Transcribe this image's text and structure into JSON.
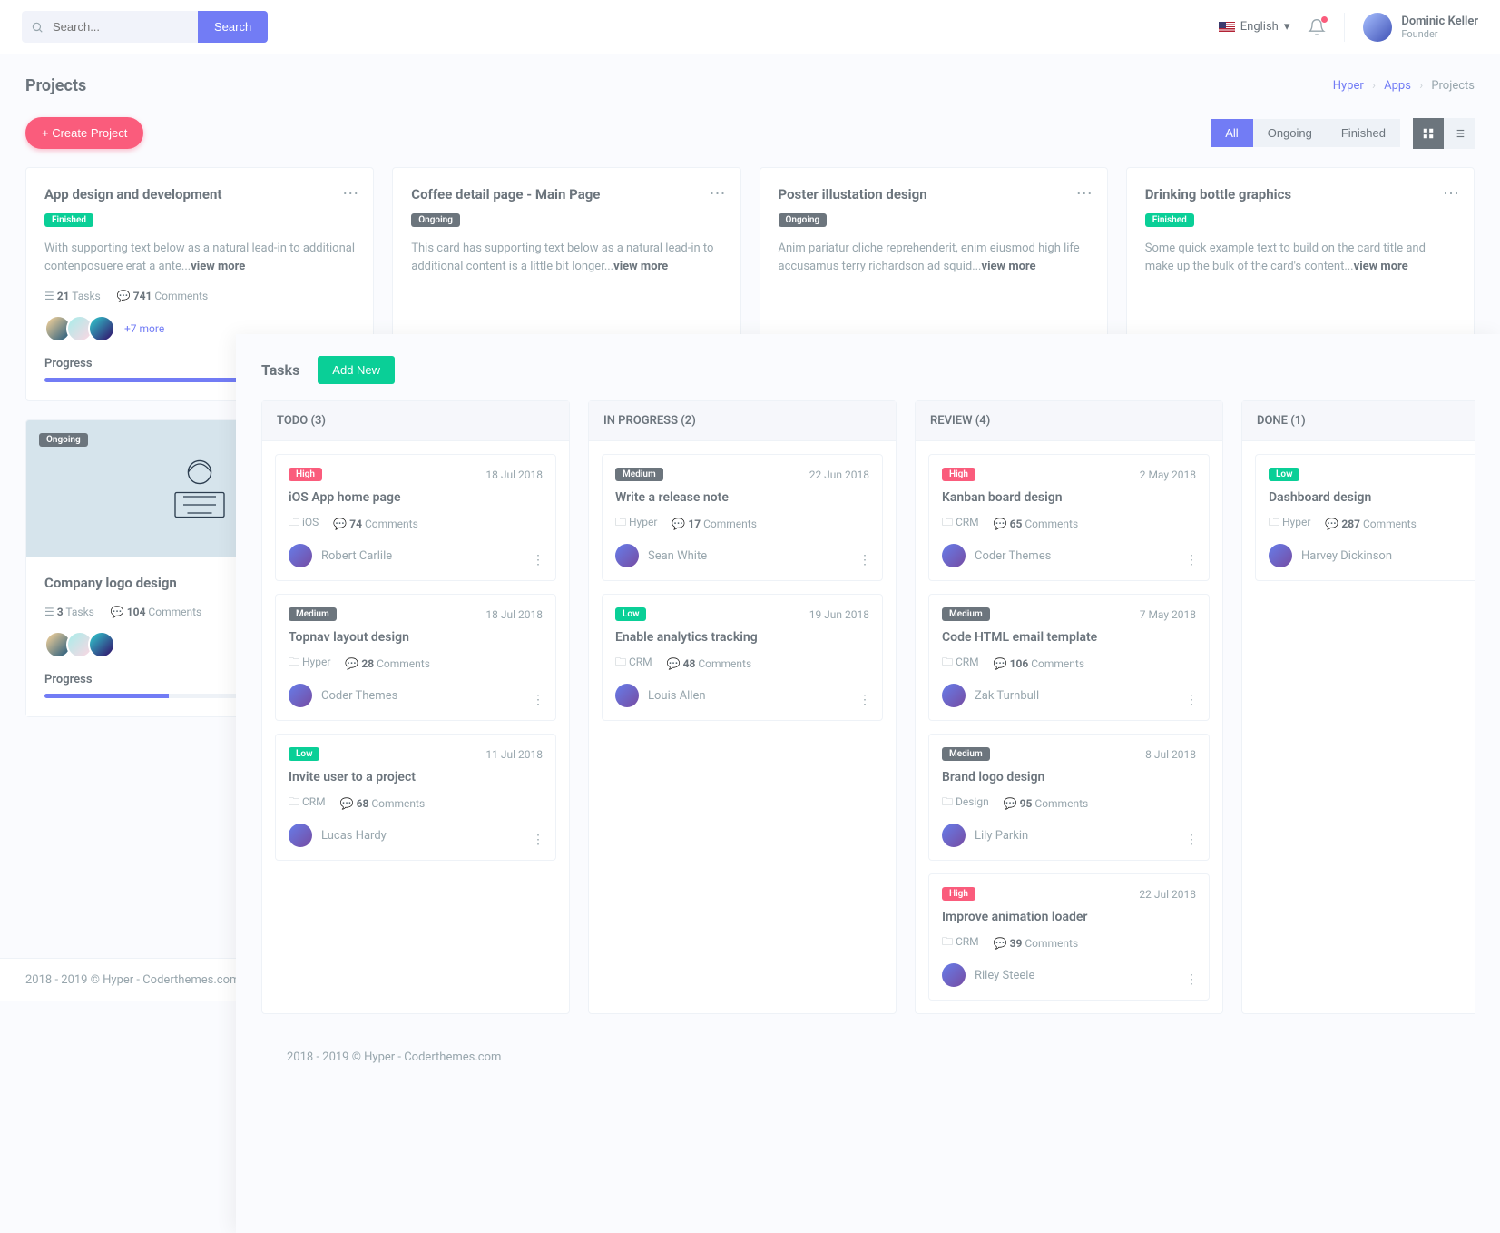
{
  "topbar": {
    "search_placeholder": "Search...",
    "search_button": "Search",
    "language": "English",
    "user_name": "Dominic Keller",
    "user_role": "Founder"
  },
  "page": {
    "title": "Projects",
    "breadcrumb": [
      "Hyper",
      "Apps",
      "Projects"
    ]
  },
  "toolbar": {
    "create_label": "Create Project",
    "filters": [
      "All",
      "Ongoing",
      "Finished"
    ],
    "active_filter": "All"
  },
  "projects": [
    {
      "title": "App design and development",
      "status": "Finished",
      "desc": "With supporting text below as a natural lead-in to additional contenposuere erat a ante...",
      "tasks": 21,
      "comments": 741,
      "extra_members": "+7 more",
      "progress": 85
    },
    {
      "title": "Coffee detail page - Main Page",
      "status": "Ongoing",
      "desc": "This card has supporting text below as a natural lead-in to additional content is a little bit longer..."
    },
    {
      "title": "Poster illustation design",
      "status": "Ongoing",
      "desc": "Anim pariatur cliche reprehenderit, enim eiusmod high life accusamus terry richardson ad squid..."
    },
    {
      "title": "Drinking bottle graphics",
      "status": "Finished",
      "desc": "Some quick example text to build on the card title and make up the bulk of the card's content..."
    },
    {
      "title": "Company logo design",
      "status": "Ongoing",
      "tasks": 3,
      "comments": 104,
      "progress": 40,
      "image": true
    }
  ],
  "view_more_label": "view more",
  "progress_label": "Progress",
  "tasks_label_suffix": "Tasks",
  "comments_label_suffix": "Comments",
  "footer_text": "2018 - 2019 © Hyper - Coderthemes.com",
  "tasks_panel": {
    "title": "Tasks",
    "add_label": "Add New",
    "columns": [
      {
        "name": "TODO (3)",
        "cards": [
          {
            "priority": "High",
            "date": "18 Jul 2018",
            "title": "iOS App home page",
            "project": "iOS",
            "comments": 74,
            "assignee": "Robert Carlile"
          },
          {
            "priority": "Medium",
            "date": "18 Jul 2018",
            "title": "Topnav layout design",
            "project": "Hyper",
            "comments": 28,
            "assignee": "Coder Themes"
          },
          {
            "priority": "Low",
            "date": "11 Jul 2018",
            "title": "Invite user to a project",
            "project": "CRM",
            "comments": 68,
            "assignee": "Lucas Hardy"
          }
        ]
      },
      {
        "name": "IN PROGRESS (2)",
        "cards": [
          {
            "priority": "Medium",
            "date": "22 Jun 2018",
            "title": "Write a release note",
            "project": "Hyper",
            "comments": 17,
            "assignee": "Sean White"
          },
          {
            "priority": "Low",
            "date": "19 Jun 2018",
            "title": "Enable analytics tracking",
            "project": "CRM",
            "comments": 48,
            "assignee": "Louis Allen"
          }
        ]
      },
      {
        "name": "REVIEW (4)",
        "cards": [
          {
            "priority": "High",
            "date": "2 May 2018",
            "title": "Kanban board design",
            "project": "CRM",
            "comments": 65,
            "assignee": "Coder Themes"
          },
          {
            "priority": "Medium",
            "date": "7 May 2018",
            "title": "Code HTML email template",
            "project": "CRM",
            "comments": 106,
            "assignee": "Zak Turnbull"
          },
          {
            "priority": "Medium",
            "date": "8 Jul 2018",
            "title": "Brand logo design",
            "project": "Design",
            "comments": 95,
            "assignee": "Lily Parkin"
          },
          {
            "priority": "High",
            "date": "22 Jul 2018",
            "title": "Improve animation loader",
            "project": "CRM",
            "comments": 39,
            "assignee": "Riley Steele"
          }
        ]
      },
      {
        "name": "DONE (1)",
        "cards": [
          {
            "priority": "Low",
            "date": "",
            "title": "Dashboard design",
            "project": "Hyper",
            "comments": 287,
            "assignee": "Harvey Dickinson"
          }
        ]
      }
    ]
  }
}
